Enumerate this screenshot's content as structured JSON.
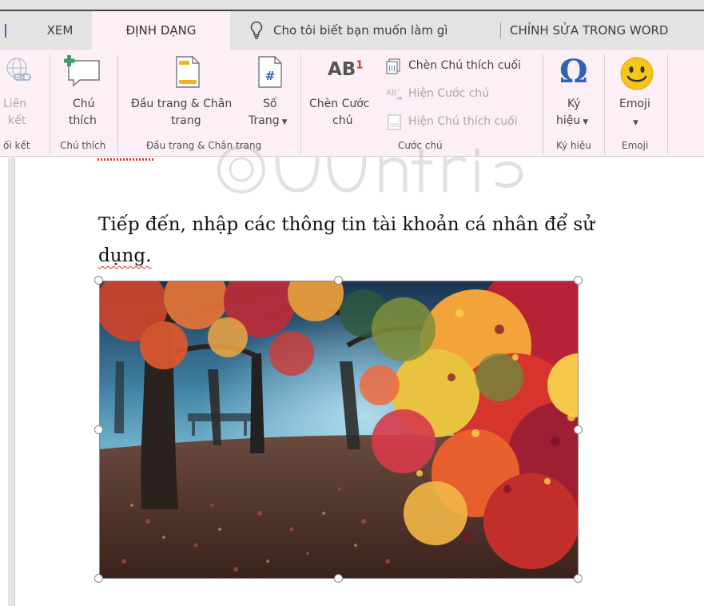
{
  "tabs": {
    "xem": "XEM",
    "dinh_dang": "ĐỊNH DẠNG",
    "tell_me": "Cho tôi biết bạn muốn làm gì",
    "edit_in_word": "CHỈNH SỬA TRONG WORD"
  },
  "ribbon": {
    "links_group": {
      "label_line1": "Liên",
      "label_line2": "kết",
      "group": "ối kết"
    },
    "comment_group": {
      "label_line1": "Chú",
      "label_line2": "thích",
      "group": "Chú thích"
    },
    "header_footer_group": {
      "header_footer_line1": "Đầu trang & Chân",
      "header_footer_line2": "trang",
      "page_number_line1": "Số",
      "page_number_line2": "Trang",
      "group": "Đầu trang & Chân trang"
    },
    "footnote_group": {
      "insert_footnote_line1": "Chèn Cước",
      "insert_footnote_line2": "chú",
      "insert_endnote": "Chèn Chú thích cuối",
      "show_footnotes": "Hiện Cước chú",
      "show_endnotes": "Hiện Chú thích cuối",
      "group": "Cước chú"
    },
    "symbols_group": {
      "label_line1": "Ký",
      "label_line2": "hiệu",
      "group": "Ký hiệu"
    },
    "emoji_group": {
      "label": "Emoji",
      "group": "Emoji"
    },
    "icon_glyphs": {
      "footnote_ab": "AB",
      "footnote_sup": "1",
      "omega": "Ω",
      "page_hash": "#"
    }
  },
  "document": {
    "paragraph_line1": "Tiếp đến, nhập các thông tin tài khoản cá nhân để sử",
    "paragraph_line2": "dụng."
  },
  "colors": {
    "ribbon_bg": "#fcf0f6",
    "tabstrip_bg": "#e3e3e3",
    "accent_blue": "#2e63b8",
    "emoji_yellow": "#f5c518",
    "spell_red": "#e0312d"
  }
}
